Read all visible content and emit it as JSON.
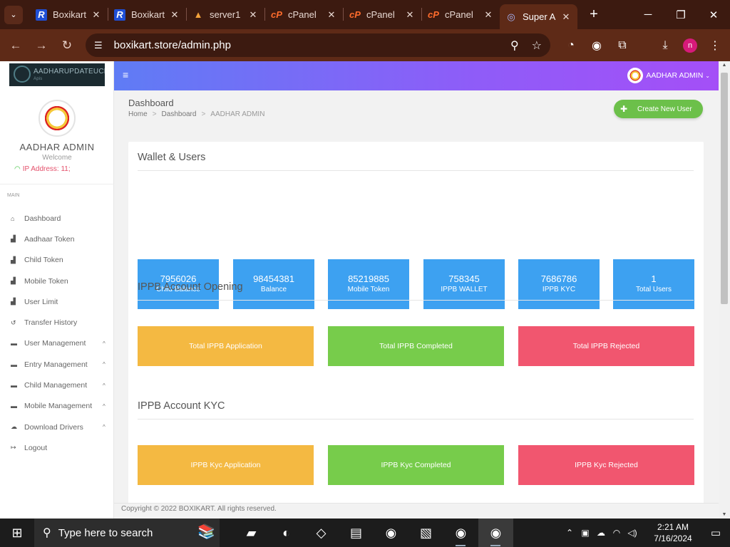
{
  "browser": {
    "tabs": [
      {
        "title": "Boxikart",
        "icon": "R",
        "icon_style": "r",
        "active": false
      },
      {
        "title": "Boxikart",
        "icon": "R",
        "icon_style": "r",
        "active": false
      },
      {
        "title": "server1",
        "icon": "▲",
        "icon_style": "mtn",
        "active": false
      },
      {
        "title": "cPanel",
        "icon": "cP",
        "icon_style": "cp",
        "active": false
      },
      {
        "title": "cPanel",
        "icon": "cP",
        "icon_style": "cp",
        "active": false
      },
      {
        "title": "cPanel",
        "icon": "cP",
        "icon_style": "cp",
        "active": false
      },
      {
        "title": "Super A",
        "icon": "◎",
        "icon_style": "fp",
        "active": true
      }
    ],
    "url": "boxikart.store/admin.php",
    "profile_initial": "n"
  },
  "sidebar": {
    "logo_text": "AADHARUPDATEUCL",
    "logo_sub": "Apis",
    "admin_name": "AADHAR ADMIN",
    "welcome": "Welcome",
    "ip_label": "IP Address: 11;",
    "section_label": "MAIN",
    "items": [
      {
        "label": "Dashboard",
        "icon": "⌂",
        "caret": ""
      },
      {
        "label": "Aadhaar Token",
        "icon": "▟",
        "caret": ""
      },
      {
        "label": "Child Token",
        "icon": "▟",
        "caret": ""
      },
      {
        "label": "Mobile Token",
        "icon": "▟",
        "caret": ""
      },
      {
        "label": "User Limit",
        "icon": "▟",
        "caret": ""
      },
      {
        "label": "Transfer History",
        "icon": "↺",
        "caret": ""
      },
      {
        "label": "User Management",
        "icon": "▬",
        "caret": "^"
      },
      {
        "label": "Entry Management",
        "icon": "▬",
        "caret": "^"
      },
      {
        "label": "Child Management",
        "icon": "▬",
        "caret": "^"
      },
      {
        "label": "Mobile Management",
        "icon": "▬",
        "caret": "^"
      },
      {
        "label": "Download Drivers",
        "icon": "☁",
        "caret": "^"
      },
      {
        "label": "Logout",
        "icon": "↦",
        "caret": ""
      }
    ]
  },
  "topbar": {
    "hamburger": "≡",
    "user_label": "AADHAR ADMIN"
  },
  "header": {
    "title": "Dashboard",
    "breadcrumb": [
      "Home",
      "Dashboard",
      "AADHAR ADMIN"
    ],
    "create_button": "Create New User"
  },
  "wallet": {
    "title": "Wallet & Users",
    "stats": [
      {
        "value": "7956026",
        "label": "Child Balance"
      },
      {
        "value": "98454381",
        "label": "Balance"
      },
      {
        "value": "85219885",
        "label": "Mobile Token"
      },
      {
        "value": "758345",
        "label": "IPPB WALLET"
      },
      {
        "value": "7686786",
        "label": "IPPB KYC"
      },
      {
        "value": "1",
        "label": "Total Users"
      }
    ]
  },
  "ippb_opening": {
    "title": "IPPB Account Opening",
    "tiles": [
      "Total IPPB Application",
      "Total IPPB Completed",
      "Total IPPB Rejected"
    ]
  },
  "ippb_kyc": {
    "title": "IPPB Account KYC",
    "tiles": [
      "IPPB Kyc Application",
      "IPPB Kyc Completed",
      "IPPB Kyc Rejected"
    ]
  },
  "footer": "Copyright © 2022  BOXIKART. All rights reserved.",
  "taskbar": {
    "search_placeholder": "Type here to search",
    "time": "2:21 AM",
    "date": "7/16/2024"
  },
  "colors": {
    "stat_blue": "#3da1f1",
    "tile_orange": "#f4b942",
    "tile_green": "#77cc4b",
    "tile_red": "#f1566f",
    "create_button": "#6cc04a"
  }
}
